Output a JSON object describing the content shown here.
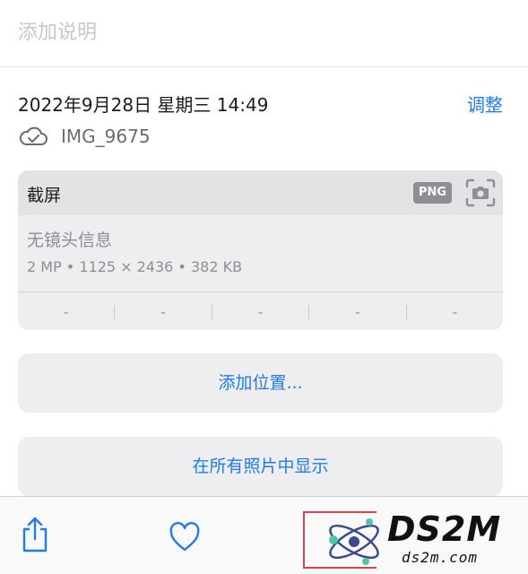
{
  "caption": {
    "placeholder": "添加说明"
  },
  "info": {
    "datetime": "2022年9月28日 星期三 14:49",
    "adjust_label": "调整",
    "filename": "IMG_9675"
  },
  "metadata": {
    "title": "截屏",
    "format_badge": "PNG",
    "lens": "无镜头信息",
    "specs": "2 MP  •  1125 × 2436  •  382 KB",
    "exif": [
      "-",
      "-",
      "-",
      "-",
      "-"
    ]
  },
  "actions": {
    "add_location": "添加位置...",
    "show_in_all_photos": "在所有照片中显示"
  },
  "toolbar": {
    "icons": [
      "share-icon",
      "heart-icon"
    ]
  },
  "watermark": {
    "brand": "DS2M",
    "site": "ds2m.com"
  },
  "colors": {
    "accent": "#1f7bf4",
    "card_bg": "#eeeef0",
    "secondary_text": "#8e8e93"
  }
}
